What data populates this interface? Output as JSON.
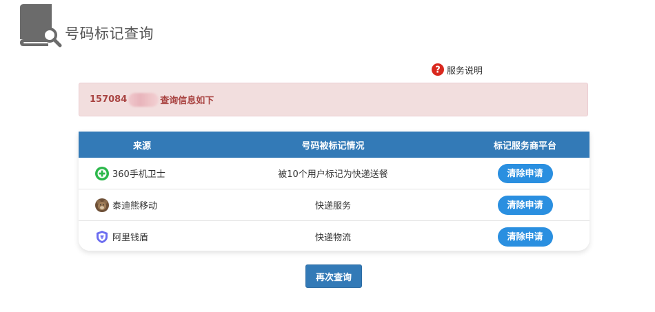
{
  "header": {
    "title": "号码标记查询",
    "icon": "book-search-icon"
  },
  "help": {
    "label": "服务说明",
    "icon": "question-circle-icon",
    "icon_color": "#d9281e"
  },
  "alert": {
    "number_visible": "157084",
    "number_masked": true,
    "suffix": "查询信息如下"
  },
  "table": {
    "headers": {
      "source": "来源",
      "status": "号码被标记情况",
      "platform": "标记服务商平台"
    },
    "rows": [
      {
        "source": "360手机卫士",
        "icon": "360-guard-icon",
        "status": "被10个用户标记为快递送餐",
        "action": "清除申请"
      },
      {
        "source": "泰迪熊移动",
        "icon": "teddy-bear-icon",
        "status": "快递服务",
        "action": "清除申请"
      },
      {
        "source": "阿里钱盾",
        "icon": "ali-shield-icon",
        "status": "快递物流",
        "action": "清除申请"
      }
    ]
  },
  "requery": {
    "label": "再次查询"
  },
  "colors": {
    "header_blue": "#337ab7",
    "button_blue": "#2a8fe0",
    "alert_bg": "#f2dede",
    "alert_text": "#a94442"
  }
}
